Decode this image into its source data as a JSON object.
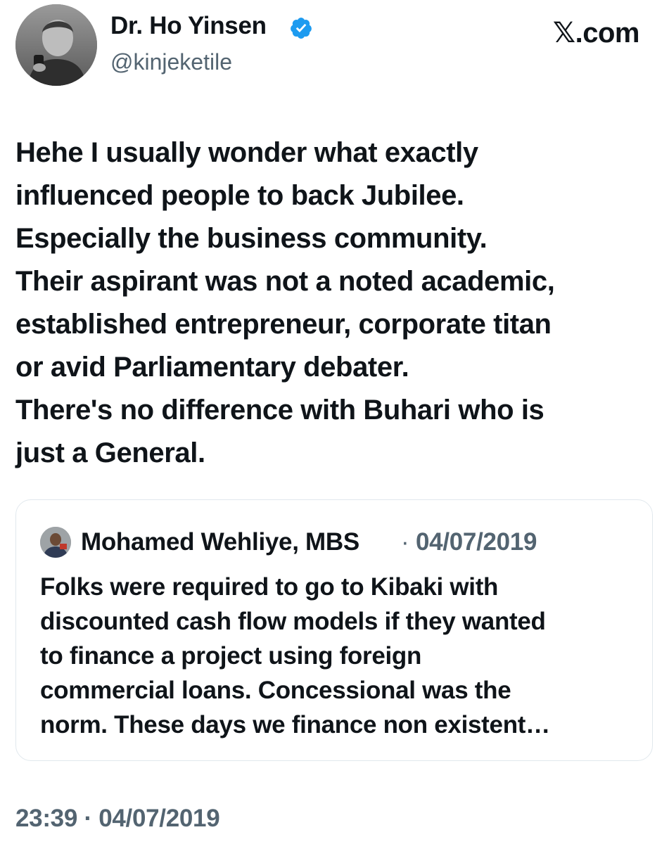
{
  "author": {
    "display_name": "Dr. Ho Yinsen",
    "handle": "@kinjeketile",
    "verified_icon": "verified-badge-icon",
    "badge_color": "#1d9bf0"
  },
  "brand": {
    "label": "𝕏.com"
  },
  "tweet": {
    "lines": [
      "Hehe I usually wonder what exactly",
      "influenced people to back Jubilee.",
      "Especially the business community.",
      "Their aspirant was not a noted academic,",
      "established entrepreneur, corporate titan",
      "or avid Parliamentary debater.",
      "There's no difference with Buhari who is",
      "just a General."
    ]
  },
  "quote": {
    "author_name": "Mohamed Wehliye, MBS",
    "separator": "·",
    "date": "04/07/2019",
    "lines": [
      "Folks were required to go to Kibaki with",
      "discounted cash flow models if they wanted",
      "to finance a project using foreign",
      "commercial loans. Concessional was the",
      "norm. These days we finance non existent…"
    ]
  },
  "footer": {
    "timestamp": "23:39 · 04/07/2019"
  },
  "colors": {
    "text": "#0f1419",
    "secondary": "#536471",
    "border": "#e1e8ed"
  }
}
